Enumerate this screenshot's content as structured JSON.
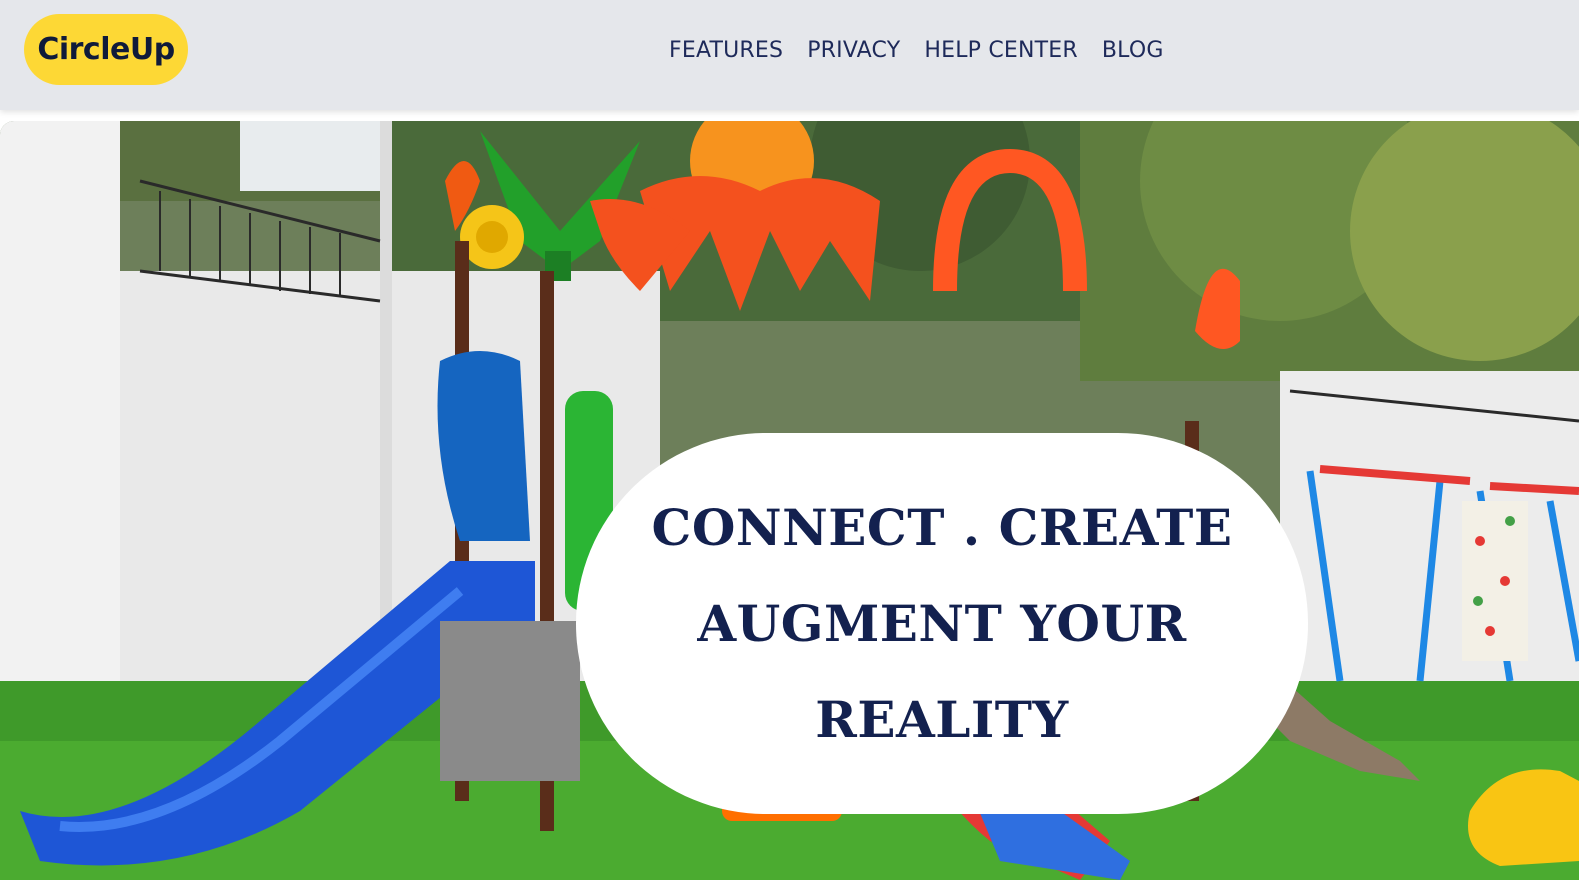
{
  "header": {
    "logo": "CircleUp",
    "nav": [
      "FEATURES",
      "PRIVACY",
      "HELP CENTER",
      "BLOG"
    ]
  },
  "hero": {
    "headline_lines": [
      "CONNECT . CREATE",
      "AUGMENT YOUR",
      "REALITY"
    ],
    "image": "playground-scene",
    "bubble_color": "#ffffff",
    "headline_color": "#13214f"
  },
  "colors": {
    "header_bg": "#e5e7eb",
    "logo_bg": "#fdd835",
    "nav_text": "#1e2a5a"
  }
}
